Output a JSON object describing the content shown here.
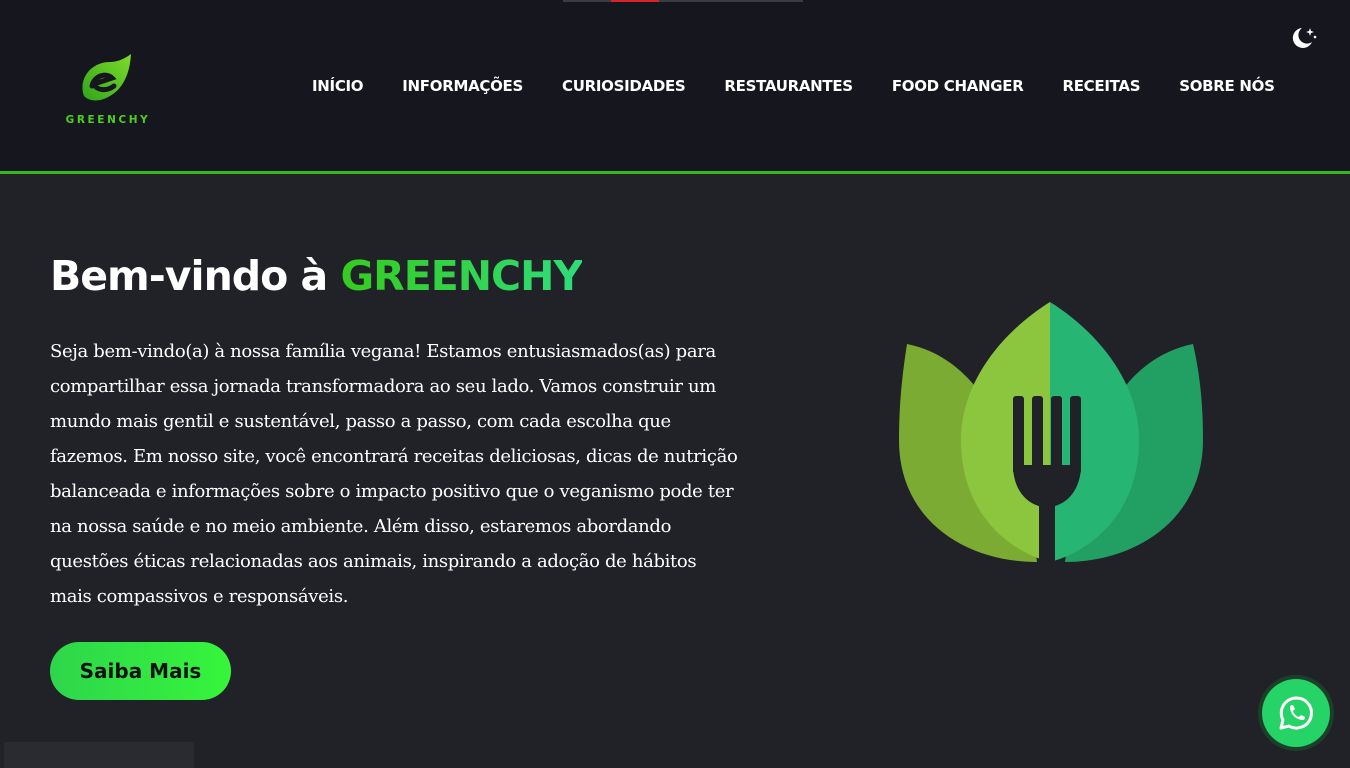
{
  "brand": {
    "logo_text": "GREENCHY",
    "accent_color": "#39b51f",
    "logo_icon": "leaf-e-icon"
  },
  "nav": {
    "items": [
      {
        "label": "INÍCIO"
      },
      {
        "label": "INFORMAÇÕES"
      },
      {
        "label": "CURIOSIDADES"
      },
      {
        "label": "RESTAURANTES"
      },
      {
        "label": "FOOD CHANGER"
      },
      {
        "label": "RECEITAS"
      },
      {
        "label": "SOBRE NÓS"
      }
    ]
  },
  "theme_toggle": {
    "icon": "moon-stars-icon"
  },
  "hero": {
    "title_prefix": "Bem-vindo à ",
    "title_brand": "GREENCHY",
    "text": "Seja bem-vindo(a) à nossa família vegana! Estamos entusiasmados(as) para compartilhar essa jornada transformadora ao seu lado. Vamos construir um mundo mais gentil e sustentável, passo a passo, com cada escolha que fazemos. Em nosso site, você encontrará receitas deliciosas, dicas de nutrição balanceada e informações sobre o impacto positivo que o veganismo pode ter na nossa saúde e no meio ambiente. Além disso, estaremos abordando questões éticas relacionadas aos animais, inspirando a adoção de hábitos mais compassivos e responsáveis.",
    "cta_label": "Saiba Mais",
    "illustration": "leaves-fork-icon"
  },
  "floating": {
    "whatsapp_icon": "whatsapp-icon"
  }
}
